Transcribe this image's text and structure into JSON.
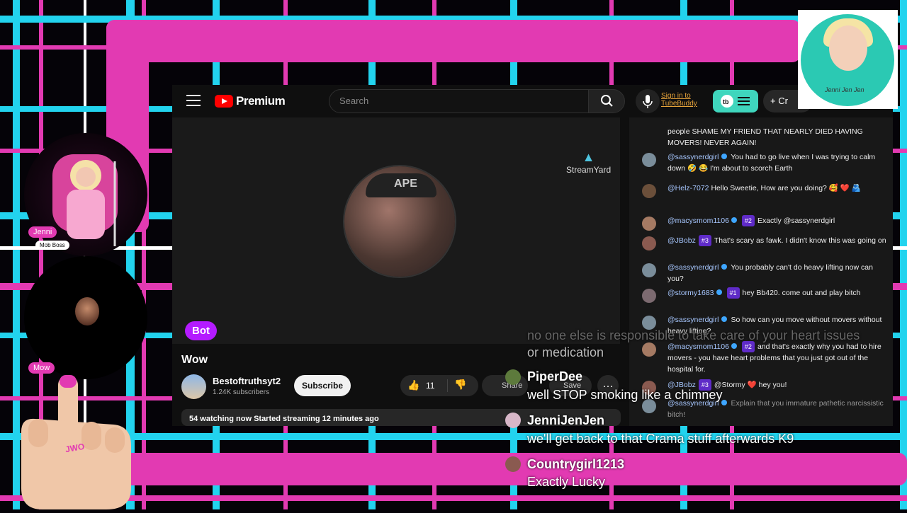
{
  "youtube": {
    "logo_text": "Premium",
    "search_placeholder": "Search",
    "tubebuddy_signin": "Sign in to TubeBuddy",
    "create_label": "+ Cr",
    "streamyard_watermark": "StreamYard",
    "avatar_cap_text": "APE",
    "bot_label": "Bot",
    "video_title": "Wow",
    "channel_name": "Bestoftruthsyt2",
    "channel_subs": "1.24K subscribers",
    "subscribe_label": "Subscribe",
    "like_count": "11",
    "share_label": "Share",
    "save_label": "Save",
    "more_label": "…",
    "desc_line": "54 watching now  Started streaming 12 minutes ago"
  },
  "chat_panel": {
    "messages": [
      {
        "author": "",
        "text": "people SHAME MY FRIEND THAT NEARLY DIED HAVING MOVERS! NEVER AGAIN!"
      },
      {
        "author": "@sassynerdgirl",
        "text": "You had to go live when I was trying to calm down 🤣 😂 I'm about to scorch Earth"
      },
      {
        "author": "@Helz-7072",
        "text": "Hello Sweetie, How are you doing? 🥰 ❤️ 🫂"
      },
      {
        "author": "@macysmom1106",
        "badge": "#2",
        "text": "Exactly @sassynerdgirl"
      },
      {
        "author": "@JBobz",
        "badge": "#3",
        "text": "That's scary as fawk. I didn't know this was going on"
      },
      {
        "author": "@sassynerdgirl",
        "text": "You probably can't do heavy lifting now can you?"
      },
      {
        "author": "@stormy1683",
        "badge": "#1",
        "text": "hey Bb420. come out and play bitch"
      },
      {
        "author": "@sassynerdgirl",
        "text": "So how can you move without movers without heavy lifting?"
      },
      {
        "author": "@macysmom1106",
        "badge": "#2",
        "text": "and that's exactly why you had to hire movers - you have heart problems that you just got out of the hospital for."
      },
      {
        "author": "@JBobz",
        "badge": "#3",
        "text": "@Stormy ❤️ hey you!"
      },
      {
        "author": "@sassynerdgirl",
        "text": "Explain that you immature pathetic narcissistic bitch!"
      }
    ]
  },
  "overlay": {
    "faded_line_1": "no one else is responsible to take care of your heart issues",
    "faded_line_2": "or medication",
    "comments": [
      {
        "name": "PiperDee",
        "text": "well STOP smoking like a chimney"
      },
      {
        "name": "JenniJenJen",
        "text": "we'll get back to that Crama stuff afterwards K9"
      },
      {
        "name": "Countrygirl1213",
        "text": "Exactly Lucky"
      }
    ]
  },
  "cams": {
    "host_name": "Jenni",
    "host_role": "Mob Boss",
    "guest_name": "Mow"
  },
  "hand_text": "JWO",
  "logo_signature": "Jenni Jen Jen",
  "colors": {
    "accent_pink": "#e23ab2",
    "cyan": "#22d3ee",
    "yt_red": "#ff0000"
  }
}
